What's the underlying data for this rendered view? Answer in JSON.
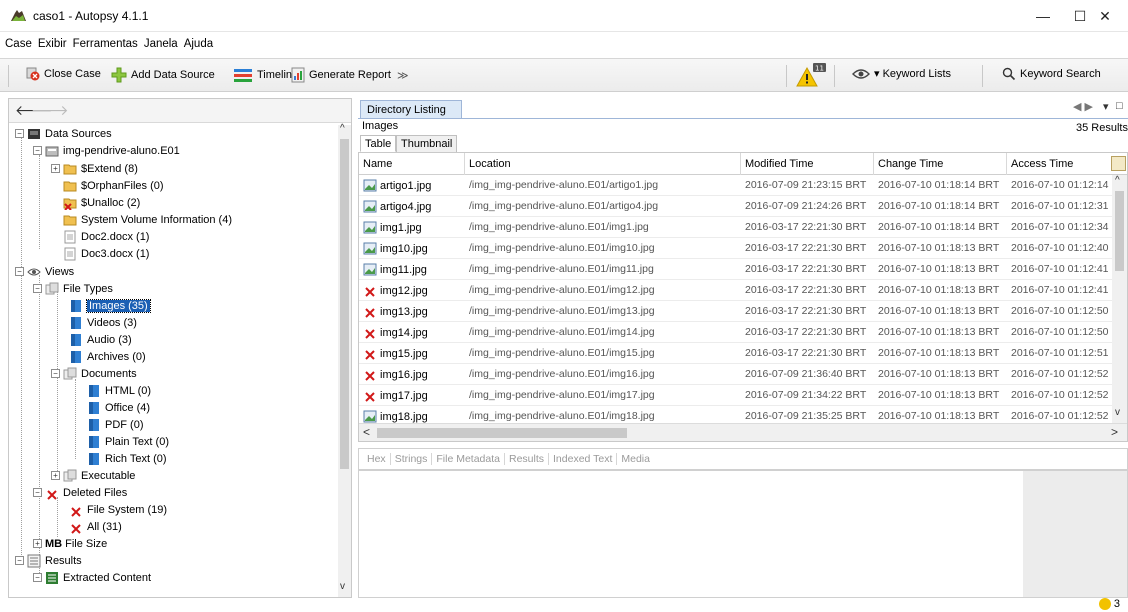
{
  "window": {
    "title": "caso1 - Autopsy 4.1.1",
    "minimize": "—",
    "maximize": "☐",
    "close": "✕"
  },
  "menu": [
    "Case",
    "Exibir",
    "Ferramentas",
    "Janela",
    "Ajuda"
  ],
  "toolbar": {
    "close_case": "Close Case",
    "add_data_source": "Add Data Source",
    "timeline": "Timeline",
    "generate_report": "Generate Report",
    "more": "≫",
    "keyword_lists": "▾ Keyword Lists",
    "keyword_search": "Keyword Search",
    "alert_count": "11"
  },
  "tree": {
    "data_sources": "Data Sources",
    "image": "img-pendrive-aluno.E01",
    "extend": "$Extend (8)",
    "orphan": "$OrphanFiles (0)",
    "unalloc": "$Unalloc (2)",
    "svi": "System Volume Information (4)",
    "doc2": "Doc2.docx (1)",
    "doc3": "Doc3.docx (1)",
    "views": "Views",
    "file_types": "File Types",
    "images": "Images (35)",
    "videos": "Videos (3)",
    "audio": "Audio (3)",
    "archives": "Archives (0)",
    "documents": "Documents",
    "html": "HTML (0)",
    "office": "Office (4)",
    "pdf": "PDF (0)",
    "plain": "Plain Text (0)",
    "rich": "Rich Text (0)",
    "executable": "Executable",
    "deleted": "Deleted Files",
    "fs": "File System (19)",
    "all": "All (31)",
    "mb": "MB",
    "file_size": "File Size",
    "results": "Results",
    "extracted": "Extracted Content"
  },
  "listing": {
    "tab": "Directory Listing",
    "heading": "Images",
    "results_count": "35 Results",
    "subtab_table": "Table",
    "subtab_thumbnail": "Thumbnail",
    "columns": [
      "Name",
      "Location",
      "Modified Time",
      "Change Time",
      "Access Time"
    ],
    "rows": [
      {
        "name": "artigo1.jpg",
        "deleted": false,
        "location": "/img_img-pendrive-aluno.E01/artigo1.jpg",
        "modified": "2016-07-09 21:23:15 BRT",
        "change": "2016-07-10 01:18:14 BRT",
        "access": "2016-07-10 01:12:14"
      },
      {
        "name": "artigo4.jpg",
        "deleted": false,
        "location": "/img_img-pendrive-aluno.E01/artigo4.jpg",
        "modified": "2016-07-09 21:24:26 BRT",
        "change": "2016-07-10 01:18:14 BRT",
        "access": "2016-07-10 01:12:31"
      },
      {
        "name": "img1.jpg",
        "deleted": false,
        "location": "/img_img-pendrive-aluno.E01/img1.jpg",
        "modified": "2016-03-17 22:21:30 BRT",
        "change": "2016-07-10 01:18:14 BRT",
        "access": "2016-07-10 01:12:34"
      },
      {
        "name": "img10.jpg",
        "deleted": false,
        "location": "/img_img-pendrive-aluno.E01/img10.jpg",
        "modified": "2016-03-17 22:21:30 BRT",
        "change": "2016-07-10 01:18:13 BRT",
        "access": "2016-07-10 01:12:40"
      },
      {
        "name": "img11.jpg",
        "deleted": false,
        "location": "/img_img-pendrive-aluno.E01/img11.jpg",
        "modified": "2016-03-17 22:21:30 BRT",
        "change": "2016-07-10 01:18:13 BRT",
        "access": "2016-07-10 01:12:41"
      },
      {
        "name": "img12.jpg",
        "deleted": true,
        "location": "/img_img-pendrive-aluno.E01/img12.jpg",
        "modified": "2016-03-17 22:21:30 BRT",
        "change": "2016-07-10 01:18:13 BRT",
        "access": "2016-07-10 01:12:41"
      },
      {
        "name": "img13.jpg",
        "deleted": true,
        "location": "/img_img-pendrive-aluno.E01/img13.jpg",
        "modified": "2016-03-17 22:21:30 BRT",
        "change": "2016-07-10 01:18:13 BRT",
        "access": "2016-07-10 01:12:50"
      },
      {
        "name": "img14.jpg",
        "deleted": true,
        "location": "/img_img-pendrive-aluno.E01/img14.jpg",
        "modified": "2016-03-17 22:21:30 BRT",
        "change": "2016-07-10 01:18:13 BRT",
        "access": "2016-07-10 01:12:50"
      },
      {
        "name": "img15.jpg",
        "deleted": true,
        "location": "/img_img-pendrive-aluno.E01/img15.jpg",
        "modified": "2016-03-17 22:21:30 BRT",
        "change": "2016-07-10 01:18:13 BRT",
        "access": "2016-07-10 01:12:51"
      },
      {
        "name": "img16.jpg",
        "deleted": true,
        "location": "/img_img-pendrive-aluno.E01/img16.jpg",
        "modified": "2016-07-09 21:36:40 BRT",
        "change": "2016-07-10 01:18:13 BRT",
        "access": "2016-07-10 01:12:52"
      },
      {
        "name": "img17.jpg",
        "deleted": true,
        "location": "/img_img-pendrive-aluno.E01/img17.jpg",
        "modified": "2016-07-09 21:34:22 BRT",
        "change": "2016-07-10 01:18:13 BRT",
        "access": "2016-07-10 01:12:52"
      },
      {
        "name": "img18.jpg",
        "deleted": false,
        "location": "/img_img-pendrive-aluno.E01/img18.jpg",
        "modified": "2016-07-09 21:35:25 BRT",
        "change": "2016-07-10 01:18:13 BRT",
        "access": "2016-07-10 01:12:52"
      }
    ]
  },
  "viewer_tabs": [
    "Hex",
    "Strings",
    "File Metadata",
    "Results",
    "Indexed Text",
    "Media"
  ],
  "status": {
    "count": "3"
  },
  "colors": {
    "selection": "#1a5fb4",
    "tab_bg": "#dce9f7",
    "deleted_x": "#d11818",
    "toolbar_bg": "#ececec"
  }
}
